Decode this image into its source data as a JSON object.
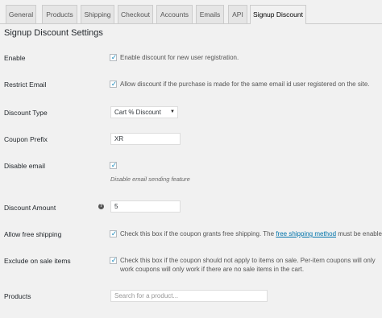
{
  "tabs": [
    {
      "label": "General"
    },
    {
      "label": "Products"
    },
    {
      "label": "Shipping"
    },
    {
      "label": "Checkout"
    },
    {
      "label": "Accounts"
    },
    {
      "label": "Emails"
    },
    {
      "label": "API"
    },
    {
      "label": "Signup Discount",
      "active": true
    }
  ],
  "section_title": "Signup Discount Settings",
  "fields": {
    "enable": {
      "label": "Enable",
      "checked": true,
      "text": "Enable discount for new user registration."
    },
    "restrict_email": {
      "label": "Restrict Email",
      "checked": true,
      "text": "Allow discount if the purchase is made for the same email id user registered on the site."
    },
    "discount_type": {
      "label": "Discount Type",
      "value": "Cart % Discount"
    },
    "coupon_prefix": {
      "label": "Coupon Prefix",
      "value": "XR"
    },
    "disable_email": {
      "label": "Disable email",
      "checked": true,
      "description": "Disable email sending feature"
    },
    "discount_amount": {
      "label": "Discount Amount",
      "value": "5"
    },
    "free_shipping": {
      "label": "Allow free shipping",
      "checked": true,
      "text_before": "Check this box if the coupon grants free shipping. The ",
      "link": "free shipping method",
      "text_after": " must be enabled w"
    },
    "exclude_sale": {
      "label": "Exclude on sale items",
      "checked": true,
      "text": "Check this box if the coupon should not apply to items on sale. Per-item coupons will only work coupons will only work if there are no sale items in the cart."
    },
    "products": {
      "label": "Products",
      "placeholder": "Search for a product..."
    }
  },
  "icons": {
    "help": "help-icon",
    "checkmark": "checkmark-icon",
    "dropdown": "dropdown-arrow-icon"
  },
  "colors": {
    "accent": "#0073aa",
    "check": "#1e8cbe",
    "background": "#f1f1f1"
  }
}
